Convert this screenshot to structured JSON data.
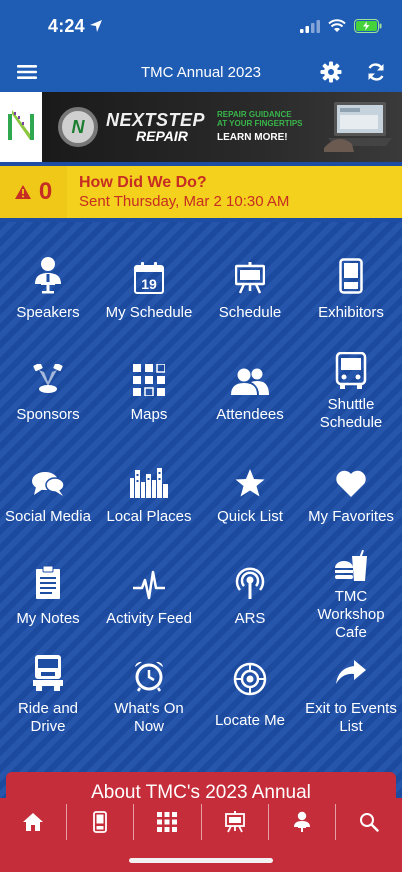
{
  "status": {
    "time": "4:24"
  },
  "appbar": {
    "title": "TMC Annual 2023"
  },
  "banner": {
    "brand_line1": "NEXTSTEP",
    "brand_line2": "REPAIR",
    "tagline1": "REPAIR GUIDANCE",
    "tagline2": "AT YOUR FINGERTIPS",
    "cta": "LEARN MORE!"
  },
  "alert": {
    "count": "0",
    "title": "How Did We Do?",
    "subtitle": "Sent Thursday, Mar 2 10:30 AM"
  },
  "tiles": [
    {
      "label": "Speakers",
      "icon": "speaker-icon"
    },
    {
      "label": "My Schedule",
      "icon": "calendar-icon",
      "calendar_day": "19"
    },
    {
      "label": "Schedule",
      "icon": "easel-icon"
    },
    {
      "label": "Exhibitors",
      "icon": "booth-icon"
    },
    {
      "label": "Sponsors",
      "icon": "spotlight-icon"
    },
    {
      "label": "Maps",
      "icon": "floorplan-grid-icon"
    },
    {
      "label": "Attendees",
      "icon": "people-icon"
    },
    {
      "label": "Shuttle Schedule",
      "icon": "bus-icon"
    },
    {
      "label": "Social Media",
      "icon": "chat-bubbles-icon"
    },
    {
      "label": "Local Places",
      "icon": "city-skyline-icon"
    },
    {
      "label": "Quick List",
      "icon": "star-icon"
    },
    {
      "label": "My Favorites",
      "icon": "heart-icon"
    },
    {
      "label": "My Notes",
      "icon": "notepad-icon"
    },
    {
      "label": "Activity Feed",
      "icon": "pulse-icon"
    },
    {
      "label": "ARS",
      "icon": "broadcast-icon"
    },
    {
      "label": "TMC Workshop Cafe",
      "icon": "burger-drink-icon"
    },
    {
      "label": "Ride and Drive",
      "icon": "truck-icon"
    },
    {
      "label": "What's On Now",
      "icon": "alarm-clock-icon"
    },
    {
      "label": "Locate Me",
      "icon": "crosshair-icon"
    },
    {
      "label": "Exit to Events List",
      "icon": "share-arrow-icon"
    }
  ],
  "about": {
    "label": "About TMC's 2023 Annual"
  },
  "tabbar": [
    {
      "icon": "home-icon"
    },
    {
      "icon": "booth-icon"
    },
    {
      "icon": "floorplan-grid-icon"
    },
    {
      "icon": "easel-icon"
    },
    {
      "icon": "speaker-icon"
    },
    {
      "icon": "search-icon"
    }
  ]
}
